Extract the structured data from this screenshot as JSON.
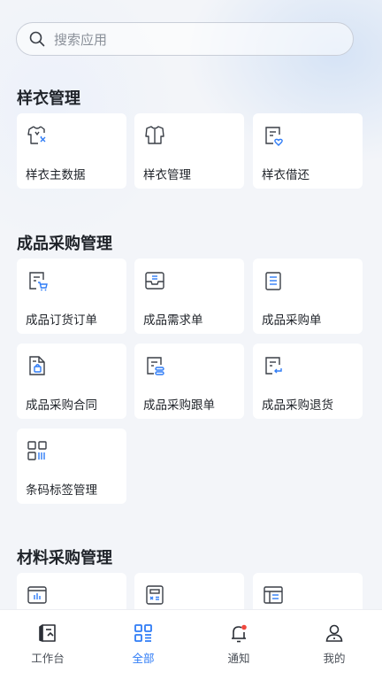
{
  "search": {
    "placeholder": "搜索应用"
  },
  "sections": [
    {
      "title": "样衣管理",
      "items": [
        {
          "label": "样衣主数据",
          "icon": "garment-data-icon"
        },
        {
          "label": "样衣管理",
          "icon": "garment-icon"
        },
        {
          "label": "样衣借还",
          "icon": "doc-heart-icon"
        }
      ]
    },
    {
      "title": "成品采购管理",
      "items": [
        {
          "label": "成品订货订单",
          "icon": "doc-cart-icon"
        },
        {
          "label": "成品需求单",
          "icon": "inbox-icon"
        },
        {
          "label": "成品采购单",
          "icon": "list-doc-icon"
        },
        {
          "label": "成品采购合同",
          "icon": "contract-icon"
        },
        {
          "label": "成品采购跟单",
          "icon": "doc-link-icon"
        },
        {
          "label": "成品采购退货",
          "icon": "doc-return-icon"
        },
        {
          "label": "条码标签管理",
          "icon": "barcode-icon"
        }
      ]
    },
    {
      "title": "材料采购管理",
      "items": [
        {
          "label": "",
          "icon": "chart-box-icon"
        },
        {
          "label": "",
          "icon": "calculator-icon"
        },
        {
          "label": "",
          "icon": "table-icon"
        }
      ]
    }
  ],
  "tabbar": [
    {
      "label": "工作台",
      "icon": "workbench-icon",
      "active": false
    },
    {
      "label": "全部",
      "icon": "grid-icon",
      "active": true
    },
    {
      "label": "通知",
      "icon": "bell-icon",
      "active": false
    },
    {
      "label": "我的",
      "icon": "user-icon",
      "active": false
    }
  ],
  "colors": {
    "accent": "#2f7cf6",
    "badge": "#f0483e",
    "icon_stroke": "#3a3f47"
  }
}
